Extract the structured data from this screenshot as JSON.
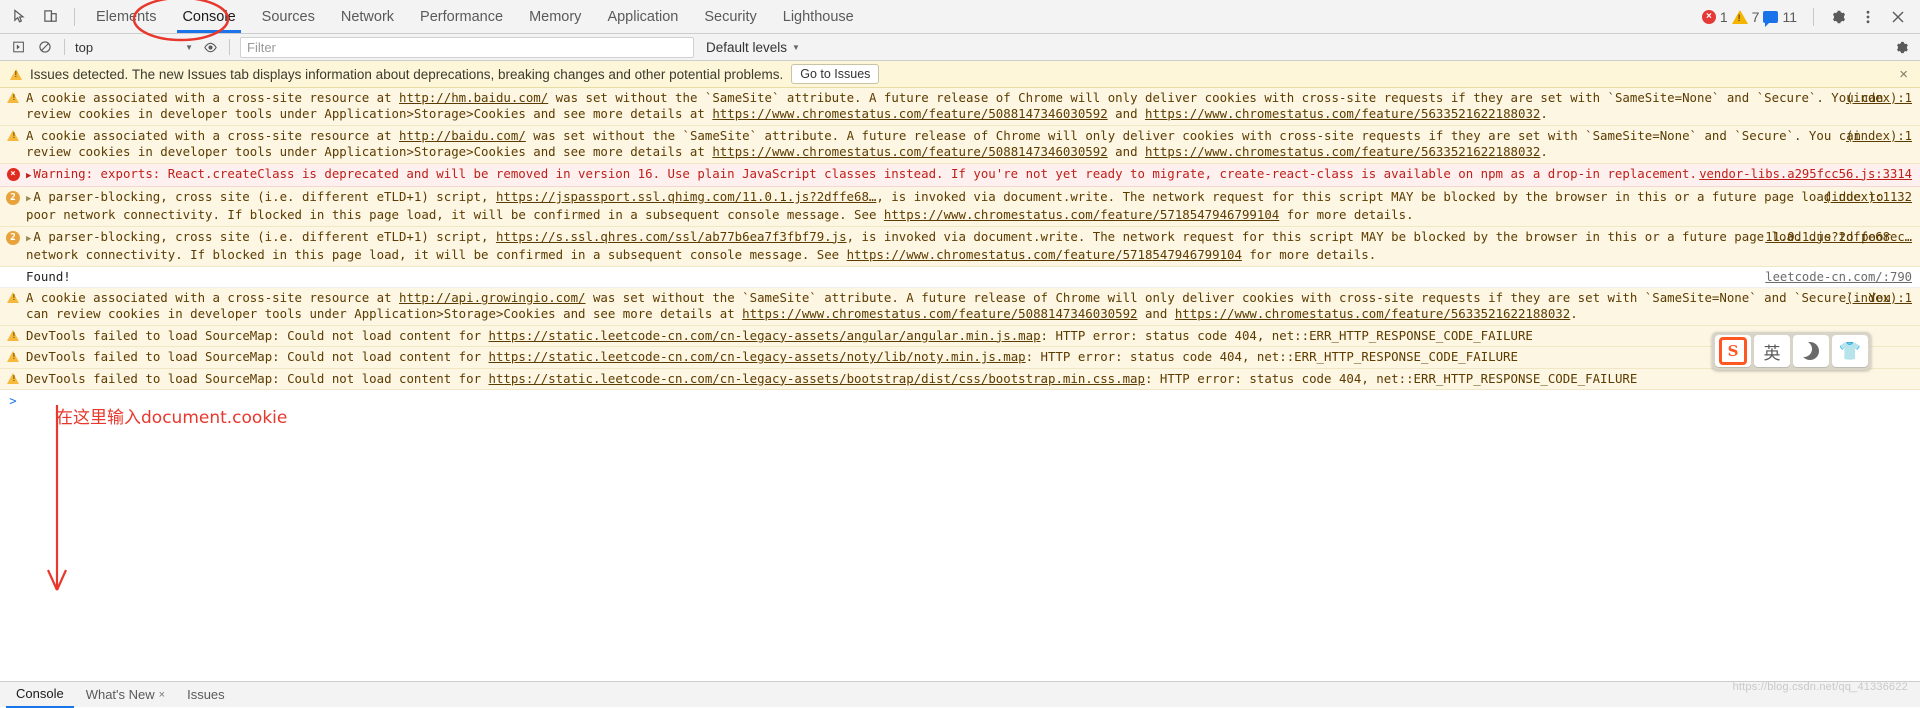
{
  "window": {
    "title": "Chrome DevTools — Console"
  },
  "toolbar": {
    "icons": [
      {
        "name": "inspect-element-icon",
        "glyph": "inspect"
      },
      {
        "name": "device-toolbar-icon",
        "glyph": "device"
      }
    ],
    "tabs": [
      {
        "label": "Elements",
        "active": false
      },
      {
        "label": "Console",
        "active": true
      },
      {
        "label": "Sources",
        "active": false
      },
      {
        "label": "Network",
        "active": false
      },
      {
        "label": "Performance",
        "active": false
      },
      {
        "label": "Memory",
        "active": false
      },
      {
        "label": "Application",
        "active": false
      },
      {
        "label": "Security",
        "active": false
      },
      {
        "label": "Lighthouse",
        "active": false
      }
    ],
    "counts": {
      "errors": "1",
      "warnings": "7",
      "infos": "11"
    },
    "settings_label": "Settings",
    "more_label": "More options",
    "close_label": "Close"
  },
  "filterbar": {
    "execute_label": "Execute",
    "clear_label": "Clear console",
    "context": "top",
    "eye_label": "Create live expression",
    "filter_placeholder": "Filter",
    "filter_value": "",
    "levels_label": "Default levels",
    "settings_label": "Console settings"
  },
  "issues_banner": {
    "text": "Issues detected. The new Issues tab displays information about deprecations, breaking changes and other potential problems.",
    "button": "Go to Issues",
    "close": "×"
  },
  "annotations": {
    "input_hint": "在这里输入document.cookie"
  },
  "ime": {
    "keys": [
      {
        "name": "sogou-logo-icon",
        "label": "S"
      },
      {
        "name": "language-mode-icon",
        "label": "英"
      },
      {
        "name": "night-mode-icon",
        "label": "moon"
      },
      {
        "name": "skin-icon",
        "label": "shirt"
      }
    ]
  },
  "drawer": {
    "tabs": [
      {
        "label": "Console",
        "active": true,
        "closable": false
      },
      {
        "label": "What's New",
        "active": false,
        "closable": true
      },
      {
        "label": "Issues",
        "active": false,
        "closable": false
      }
    ]
  },
  "watermark": "https://blog.csdn.net/qq_41336622",
  "prompt": {
    "caret": ">",
    "value": ""
  },
  "messages": [
    {
      "level": "warn",
      "icon": "warning-icon",
      "count": null,
      "expandable": false,
      "source": "(index):1",
      "parts": [
        {
          "t": "A cookie associated with a cross-site resource at ",
          "link": false
        },
        {
          "t": "http://hm.baidu.com/",
          "link": true
        },
        {
          "t": " was set without the `SameSite` attribute. A future release of Chrome will only deliver cookies with cross-site requests if they are set with `SameSite=None` and `Secure`. You can review cookies in developer tools under Application>Storage>Cookies and see more details at ",
          "link": false
        },
        {
          "t": "https://www.chromestatus.com/feature/5088147346030592",
          "link": true
        },
        {
          "t": " and ",
          "link": false
        },
        {
          "t": "https://www.chromestatus.com/feature/5633521622188032",
          "link": true
        },
        {
          "t": ".",
          "link": false
        }
      ]
    },
    {
      "level": "warn",
      "icon": "warning-icon",
      "count": null,
      "expandable": false,
      "source": "(index):1",
      "parts": [
        {
          "t": "A cookie associated with a cross-site resource at ",
          "link": false
        },
        {
          "t": "http://baidu.com/",
          "link": true
        },
        {
          "t": " was set without the `SameSite` attribute. A future release of Chrome will only deliver cookies with cross-site requests if they are set with `SameSite=None` and `Secure`. You can review cookies in developer tools under Application>Storage>Cookies and see more details at ",
          "link": false
        },
        {
          "t": "https://www.chromestatus.com/feature/5088147346030592",
          "link": true
        },
        {
          "t": " and ",
          "link": false
        },
        {
          "t": "https://www.chromestatus.com/feature/5633521622188032",
          "link": true
        },
        {
          "t": ".",
          "link": false
        }
      ]
    },
    {
      "level": "err",
      "icon": "error-icon",
      "count": null,
      "expandable": true,
      "source": "vendor-libs.a295fcc56.js:3314",
      "parts": [
        {
          "t": "Warning: exports: React.createClass is deprecated and will be removed in version 16. Use plain JavaScript classes instead. If you're not yet ready to migrate, create-react-class is available on npm as a drop-in replacement.",
          "link": false
        }
      ]
    },
    {
      "level": "warn",
      "icon": "count-badge-icon",
      "count": "2",
      "expandable": true,
      "source": "(index):1132",
      "parts": [
        {
          "t": "A parser-blocking, cross site (i.e. different eTLD+1) script, ",
          "link": false
        },
        {
          "t": "https://jspassport.ssl.qhimg.com/11.0.1.js?2dffe68…",
          "link": true
        },
        {
          "t": ", is invoked via document.write. The network request for this script MAY be blocked by the browser in this or a future page load due to poor network connectivity. If blocked in this page load, it will be confirmed in a subsequent console message. See ",
          "link": false
        },
        {
          "t": "https://www.chromestatus.com/feature/5718547946799104",
          "link": true
        },
        {
          "t": " for more details.",
          "link": false
        }
      ]
    },
    {
      "level": "warn",
      "icon": "count-badge-icon",
      "count": "2",
      "expandable": true,
      "source": "11.0.1.js?2dffe68ec…",
      "parts": [
        {
          "t": "A parser-blocking, cross site (i.e. different eTLD+1) script, ",
          "link": false
        },
        {
          "t": "https://s.ssl.qhres.com/ssl/ab77b6ea7f3fbf79.js",
          "link": true
        },
        {
          "t": ", is invoked via document.write. The network request for this script MAY be blocked by the browser in this or a future page load due to poor network connectivity. If blocked in this page load, it will be confirmed in a subsequent console message. See ",
          "link": false
        },
        {
          "t": "https://www.chromestatus.com/feature/5718547946799104",
          "link": true
        },
        {
          "t": " for more details.",
          "link": false
        }
      ]
    },
    {
      "level": "log",
      "icon": null,
      "count": null,
      "expandable": false,
      "source": "leetcode-cn.com/:790",
      "parts": [
        {
          "t": "Found!",
          "link": false
        }
      ]
    },
    {
      "level": "warn",
      "icon": "warning-icon",
      "count": null,
      "expandable": false,
      "source": "(index):1",
      "parts": [
        {
          "t": "A cookie associated with a cross-site resource at ",
          "link": false
        },
        {
          "t": "http://api.growingio.com/",
          "link": true
        },
        {
          "t": " was set without the `SameSite` attribute. A future release of Chrome will only deliver cookies with cross-site requests if they are set with `SameSite=None` and `Secure`. You can review cookies in developer tools under Application>Storage>Cookies and see more details at ",
          "link": false
        },
        {
          "t": "https://www.chromestatus.com/feature/5088147346030592",
          "link": true
        },
        {
          "t": " and ",
          "link": false
        },
        {
          "t": "https://www.chromestatus.com/feature/5633521622188032",
          "link": true
        },
        {
          "t": ".",
          "link": false
        }
      ]
    },
    {
      "level": "warn",
      "icon": "warning-icon",
      "count": null,
      "expandable": false,
      "source": "",
      "parts": [
        {
          "t": "DevTools failed to load SourceMap: Could not load content for ",
          "link": false
        },
        {
          "t": "https://static.leetcode-cn.com/cn-legacy-assets/angular/angular.min.js.map",
          "link": true
        },
        {
          "t": ": HTTP error: status code 404, net::ERR_HTTP_RESPONSE_CODE_FAILURE",
          "link": false
        }
      ]
    },
    {
      "level": "warn",
      "icon": "warning-icon",
      "count": null,
      "expandable": false,
      "source": "",
      "parts": [
        {
          "t": "DevTools failed to load SourceMap: Could not load content for ",
          "link": false
        },
        {
          "t": "https://static.leetcode-cn.com/cn-legacy-assets/noty/lib/noty.min.js.map",
          "link": true
        },
        {
          "t": ": HTTP error: status code 404, net::ERR_HTTP_RESPONSE_CODE_FAILURE",
          "link": false
        }
      ]
    },
    {
      "level": "warn",
      "icon": "warning-icon",
      "count": null,
      "expandable": false,
      "source": "",
      "parts": [
        {
          "t": "DevTools failed to load SourceMap: Could not load content for ",
          "link": false
        },
        {
          "t": "https://static.leetcode-cn.com/cn-legacy-assets/bootstrap/dist/css/bootstrap.min.css.map",
          "link": true
        },
        {
          "t": ": HTTP error: status code 404, net::ERR_HTTP_RESPONSE_CODE_FAILURE",
          "link": false
        }
      ]
    }
  ]
}
